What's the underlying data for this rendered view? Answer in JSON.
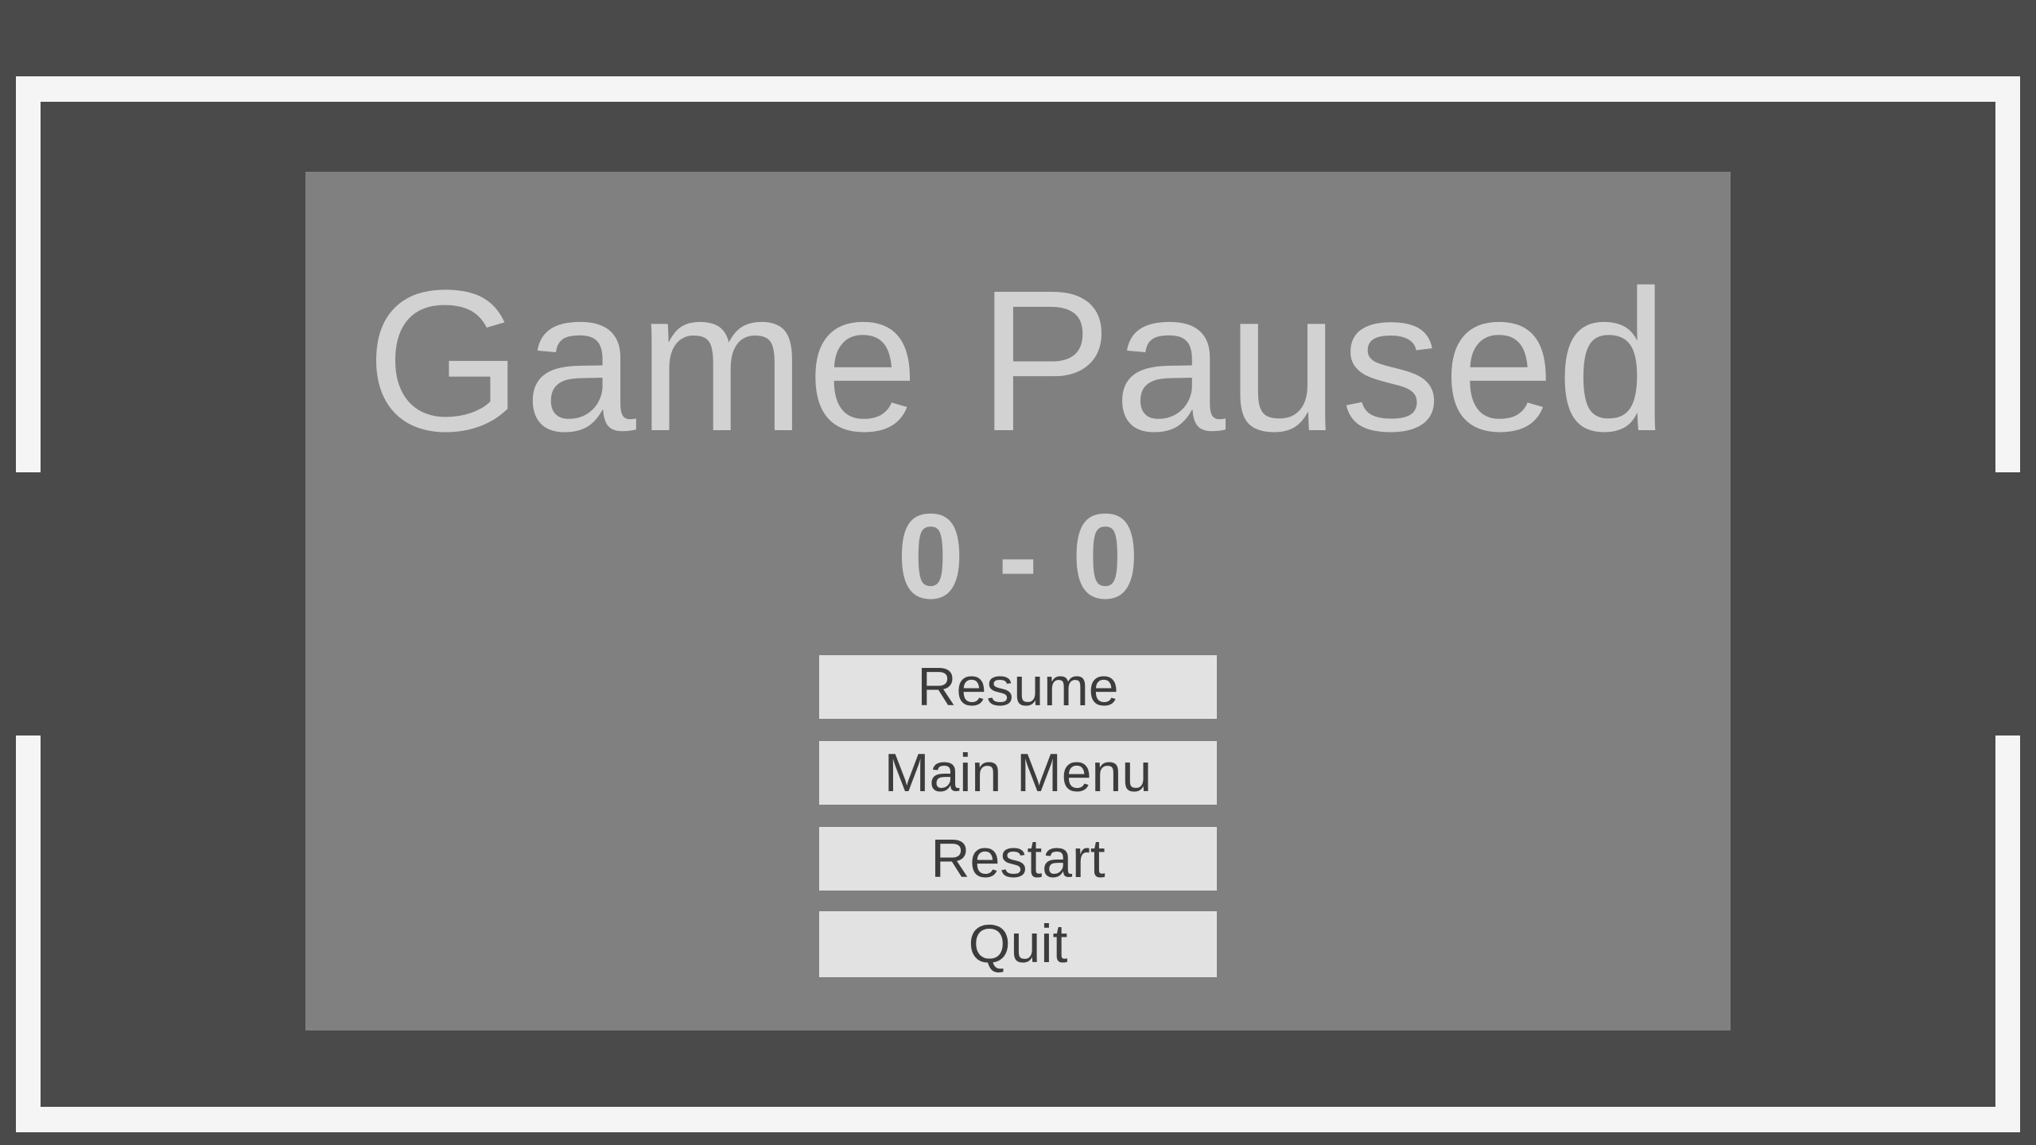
{
  "pause_menu": {
    "title": "Game Paused",
    "score": "0 - 0",
    "buttons": {
      "resume": "Resume",
      "main_menu": "Main Menu",
      "restart": "Restart",
      "quit": "Quit"
    }
  },
  "colors": {
    "background": "#4a4a4a",
    "walls": "#f5f5f5",
    "panel": "#808080",
    "title_text": "#d2d2d2",
    "button_fill": "#e2e2e2",
    "button_text": "#3c3c3c"
  }
}
